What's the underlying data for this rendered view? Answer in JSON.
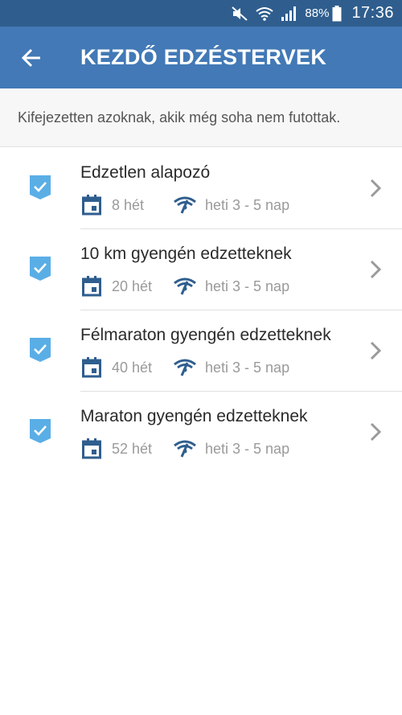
{
  "status_bar": {
    "battery": "88%",
    "time": "17:36",
    "icons": [
      "mute-icon",
      "wifi-icon",
      "signal-icon",
      "battery-icon"
    ]
  },
  "app_bar": {
    "title": "KEZDŐ EDZÉSTERVEK",
    "back_icon": "arrow-back-icon"
  },
  "subtitle": "Kifejezetten azoknak, akik még soha nem futottak.",
  "colors": {
    "status_bar": "#2f5e8e",
    "app_bar": "#4279b6",
    "badge": "#5aaee6",
    "meta_icon": "#2f5e8e",
    "meta_text": "#9a9a9a",
    "chevron": "#9a9a9a"
  },
  "plans": [
    {
      "name": "Edzetlen alapozó",
      "weeks": "8 hét",
      "frequency": "heti 3 - 5 nap"
    },
    {
      "name": "10 km gyengén edzetteknek",
      "weeks": "20 hét",
      "frequency": "heti 3 - 5 nap"
    },
    {
      "name": "Félmaraton gyengén edzetteknek",
      "weeks": "40 hét",
      "frequency": "heti 3 - 5 nap"
    },
    {
      "name": "Maraton gyengén edzetteknek",
      "weeks": "52 hét",
      "frequency": "heti 3 - 5 nap"
    }
  ]
}
